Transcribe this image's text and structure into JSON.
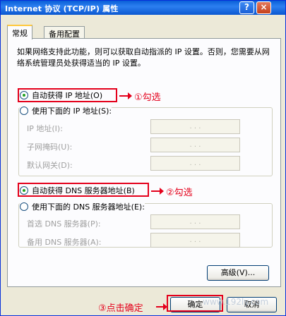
{
  "window": {
    "title": "Internet 协议 (TCP/IP) 属性",
    "help_button": "?",
    "close_button": "×"
  },
  "tabs": [
    {
      "label": "常规"
    },
    {
      "label": "备用配置"
    }
  ],
  "description": "如果网络支持此功能，则可以获取自动指派的 IP 设置。否则，您需要从网络系统管理员处获得适当的 IP 设置。",
  "ip": {
    "auto_label": "自动获得 IP 地址(O)",
    "manual_label": "使用下面的 IP 地址(S):",
    "auto_selected": true,
    "fields": [
      {
        "label": "IP 地址(I):",
        "value": ".   .   ."
      },
      {
        "label": "子网掩码(U):",
        "value": ".   .   ."
      },
      {
        "label": "默认网关(D):",
        "value": ".   .   ."
      }
    ]
  },
  "dns": {
    "auto_label": "自动获得 DNS 服务器地址(B)",
    "manual_label": "使用下面的 DNS 服务器地址(E):",
    "auto_selected": true,
    "fields": [
      {
        "label": "首选 DNS 服务器(P):",
        "value": ".   .   ."
      },
      {
        "label": "备用 DNS 服务器(A):",
        "value": ".   .   ."
      }
    ]
  },
  "annotations": {
    "step1": "①勾选",
    "step2": "②勾选",
    "step3": "③点击确定"
  },
  "buttons": {
    "advanced": "高级(V)...",
    "ok": "确定",
    "cancel": "取消"
  },
  "watermark": "www.192ly.com",
  "colors": {
    "annotation_red": "#e4001b",
    "title_blue": "#0a5fd8"
  }
}
